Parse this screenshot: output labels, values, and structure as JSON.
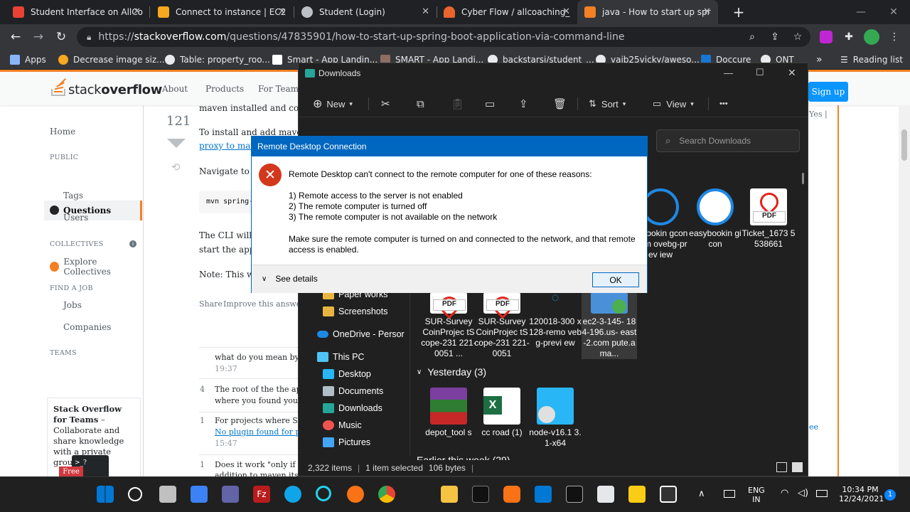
{
  "browser": {
    "tabs": [
      {
        "title": "Student Interface on AllCo",
        "color": "#e94235"
      },
      {
        "title": "Connect to instance | EC2",
        "color": "#f6a821"
      },
      {
        "title": "Student (Login)",
        "color": "#bdc1c6"
      },
      {
        "title": "Cyber Flow / allcoaching_",
        "color": "#e8652e"
      },
      {
        "title": "java - How to start up spr",
        "color": "#f48024"
      }
    ],
    "url_prefix": "https://",
    "url_host": "stackoverflow.com",
    "url_path": "/questions/47835901/how-to-start-up-spring-boot-application-via-command-line",
    "bookmarks": [
      {
        "label": "Apps",
        "color": "#8ab4f8"
      },
      {
        "label": "Decrease image siz...",
        "color": "#f6a821"
      },
      {
        "label": "Table: property_roo...",
        "color": "#e8eaed"
      },
      {
        "label": "Smart - App Landin...",
        "color": "#ffffff"
      },
      {
        "label": "SMART - App Landi...",
        "color": "#8d6e63"
      },
      {
        "label": "backstarsi/student_...",
        "color": "#e8eaed"
      },
      {
        "label": "vaib25vicky/aweso...",
        "color": "#e8eaed"
      },
      {
        "label": "Doccure",
        "color": "#1976d2"
      },
      {
        "label": "ONT",
        "color": "#e8eaed"
      }
    ],
    "reading_list": "Reading list",
    "more": "»"
  },
  "so": {
    "logo_stack": "stack",
    "logo_overflow": "overflow",
    "nav": [
      "About",
      "Products",
      "For Teams"
    ],
    "signup": "Sign up",
    "left": {
      "home": "Home",
      "public": "PUBLIC",
      "questions": "Questions",
      "tags": "Tags",
      "users": "Users",
      "collectives": "COLLECTIVES",
      "explore": "Explore Collectives",
      "findjob": "FIND A JOB",
      "jobs": "Jobs",
      "companies": "Companies",
      "teams": "TEAMS",
      "teams_title": "Stack Overflow for Teams",
      "teams_body": " – Collaborate and share knowledge with a private group.",
      "free": "Free"
    },
    "answer": {
      "votes": "121",
      "line1": "maven installed and corre",
      "line2": "To install and add maven",
      "line3": "proxy to mav",
      "line4": "Navigate to th",
      "code": "mvn spring-b",
      "line5": "The CLI will",
      "line6": "start the app i",
      "line7": "Note: This wi",
      "share": "Share",
      "improve": "Improve this answer"
    },
    "comments": [
      {
        "score": "",
        "text": "what do you mean by \"th",
        "time": "19:37"
      },
      {
        "score": "4",
        "text": "The root of the the applic",
        "text2": "where you found your th",
        "time": ""
      },
      {
        "score": "1",
        "text": "For projects where Spring",
        "text2": "No plugin found for prefi",
        "time": "15:47"
      },
      {
        "score": "1",
        "text": "Does it work \"only if you",
        "text2": "addition to maven itself?",
        "time": ""
      }
    ],
    "right_edge": [
      "ee",
      "Yes |"
    ]
  },
  "explorer": {
    "title": "Downloads",
    "toolbar": {
      "new": "New",
      "sort": "Sort",
      "view": "View",
      "more": "•••"
    },
    "search_placeholder": "Search Downloads",
    "sidebar": [
      {
        "label": "Paper works",
        "color": "#e8b640"
      },
      {
        "label": "Screenshots",
        "color": "#e8b640"
      },
      {
        "label": "OneDrive - Persor",
        "color": "#1e88e5"
      },
      {
        "label": "This PC",
        "color": "#4fc3f7"
      },
      {
        "label": "Desktop",
        "color": "#29b6f6"
      },
      {
        "label": "Documents",
        "color": "#b0bec5"
      },
      {
        "label": "Downloads",
        "color": "#26a69a"
      },
      {
        "label": "Music",
        "color": "#ef5350"
      },
      {
        "label": "Pictures",
        "color": "#42a5f5"
      },
      {
        "label": "Earlier this week (29)",
        "color": "#e8b640"
      }
    ],
    "files_top": [
      {
        "name": "ysbookin gcon-rem ovebg-prev iew",
        "icon": "calendar-icon"
      },
      {
        "name": "easybookin gicon",
        "icon": "calendar-icon"
      },
      {
        "name": "Ticket_1673 5538661",
        "icon": "pdf-icon"
      }
    ],
    "files_mid": [
      {
        "name": "SUR-Survey CoinProjec tScope-231 221-0051 ...",
        "icon": "pdf-icon"
      },
      {
        "name": "SUR-Survey CoinProjec tScope-231 221-0051",
        "icon": "pdf-icon"
      },
      {
        "name": "120018-300 x128-remo vebg-previ ew",
        "icon": "image-icon"
      },
      {
        "name": "ec2-3-145- 184-196.us- east-2.com pute.ama...",
        "icon": "rdp-icon"
      }
    ],
    "group_yesterday": "Yesterday (3)",
    "group_earlier": "Earlier this week (29)",
    "files_yesterday": [
      {
        "name": "depot_tool s",
        "icon": "winrar-icon"
      },
      {
        "name": "cc road (1)",
        "icon": "excel-icon"
      },
      {
        "name": "node-v16.1 3.1-x64",
        "icon": "installer-icon"
      }
    ],
    "status": {
      "count": "2,322 items",
      "selected": "1 item selected",
      "size": "106 bytes"
    }
  },
  "dialog": {
    "title": "Remote Desktop Connection",
    "heading": "Remote Desktop can't connect to the remote computer for one of these reasons:",
    "reasons": [
      "1) Remote access to the server is not enabled",
      "2) The remote computer is turned off",
      "3) The remote computer is not available on the network"
    ],
    "advice1": "Make sure the remote computer is turned on and connected to the network, and that remote",
    "advice2": "access is enabled.",
    "details": "See details",
    "ok": "OK"
  },
  "taskbar": {
    "lang1": "ENG",
    "lang2": "IN",
    "time": "10:34 PM",
    "date": "12/24/2021",
    "notif": "1"
  }
}
